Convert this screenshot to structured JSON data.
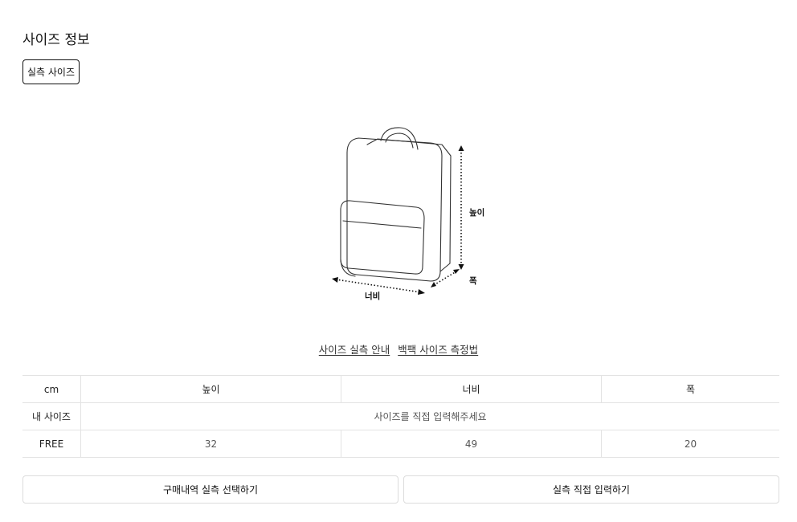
{
  "section": {
    "title": "사이즈 정보"
  },
  "tabs": [
    {
      "label": "실측 사이즈"
    }
  ],
  "diagram": {
    "icon": "backpack-icon",
    "labels": {
      "height": "높이",
      "width": "너비",
      "depth": "폭"
    }
  },
  "guides": {
    "size_guide": "사이즈 실측 안내",
    "backpack_guide": "백팩 사이즈 측정법"
  },
  "table": {
    "unit": "cm",
    "headers": [
      "높이",
      "너비",
      "폭"
    ],
    "my_size": {
      "label": "내 사이즈",
      "placeholder": "사이즈를 직접 입력해주세요"
    },
    "rows": [
      {
        "label": "FREE",
        "values": [
          "32",
          "49",
          "20"
        ]
      }
    ]
  },
  "buttons": {
    "select_purchase": "구매내역 실측 선택하기",
    "manual_input": "실측 직접 입력하기"
  }
}
